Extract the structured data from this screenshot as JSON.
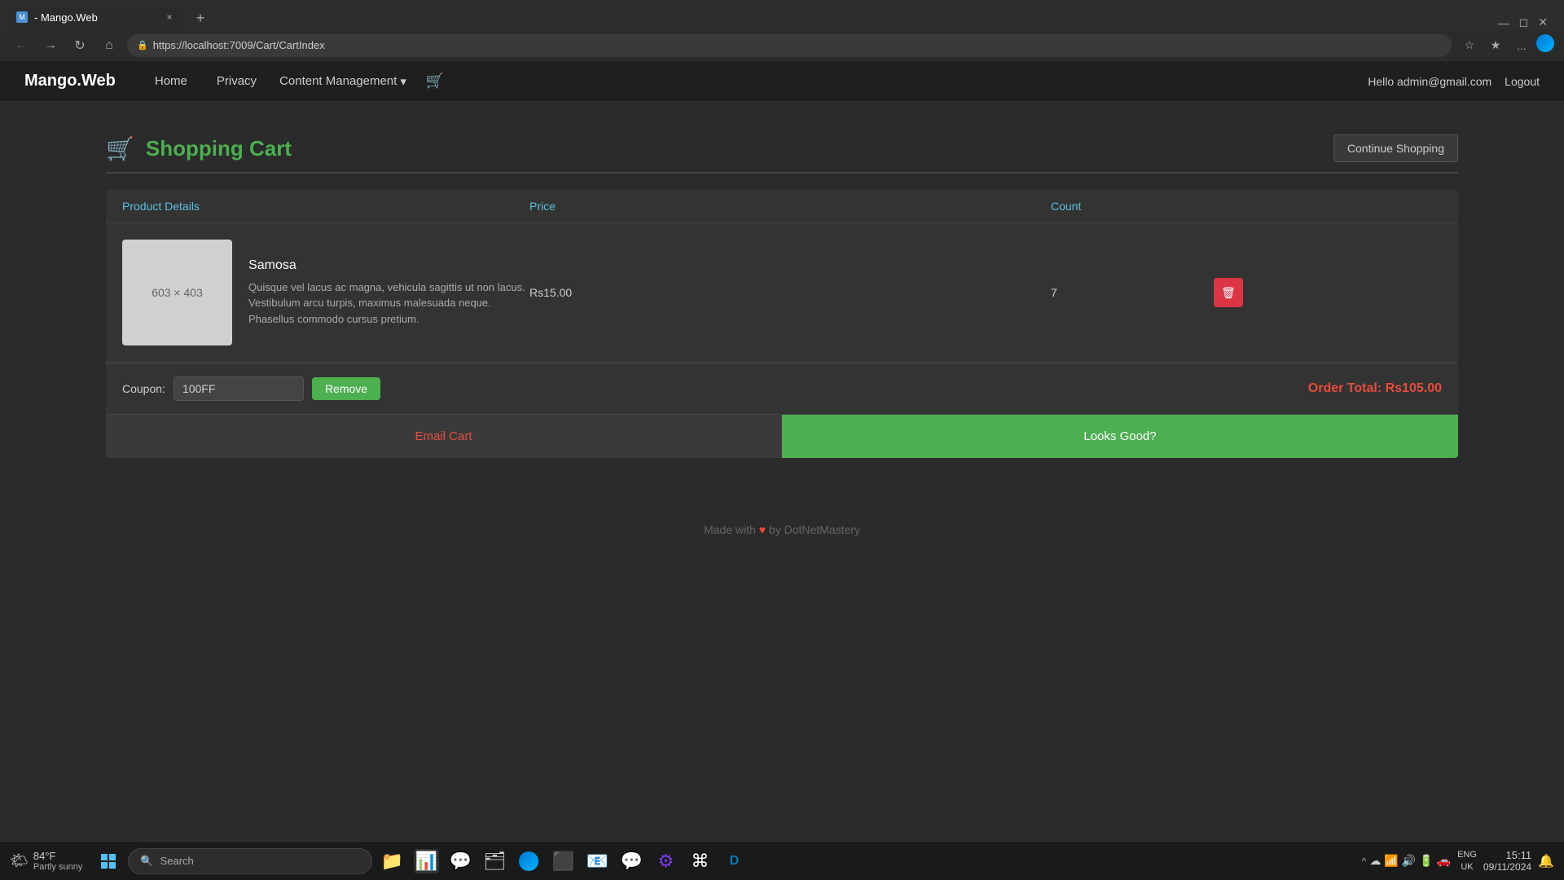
{
  "browser": {
    "tab": {
      "favicon_text": "M",
      "title": "- Mango.Web",
      "close_label": "×",
      "new_tab_label": "+"
    },
    "toolbar": {
      "back_label": "←",
      "forward_label": "→",
      "refresh_label": "↻",
      "home_label": "⌂",
      "url": "https://localhost:7009/Cart/CartIndex",
      "star_label": "☆",
      "fav_label": "★",
      "more_label": "...",
      "user_icon_label": "👤"
    }
  },
  "nav": {
    "brand": "Mango.Web",
    "links": [
      "Home",
      "Privacy"
    ],
    "dropdown": {
      "label": "Content Management",
      "arrow": "▾"
    },
    "cart_icon": "🛒",
    "user_greeting": "Hello admin@gmail.com",
    "logout_label": "Logout"
  },
  "cart": {
    "title": "Shopping Cart",
    "continue_shopping": "Continue Shopping",
    "table": {
      "headers": [
        "Product Details",
        "Price",
        "Count",
        ""
      ],
      "rows": [
        {
          "image_placeholder": "603 × 403",
          "name": "Samosa",
          "description_line1": "Quisque vel lacus ac magna, vehicula sagittis ut non lacus.",
          "description_line2": "Vestibulum arcu turpis, maximus malesuada neque. Phasellus commodo cursus pretium.",
          "price": "Rs15.00",
          "count": "7",
          "delete_icon": "🗑"
        }
      ]
    },
    "coupon": {
      "label": "Coupon:",
      "value": "100FF",
      "remove_label": "Remove"
    },
    "order_total_label": "Order Total: Rs105.00",
    "email_cart_label": "Email Cart",
    "looks_good_label": "Looks Good?"
  },
  "footer": {
    "text_prefix": "Made with",
    "heart": "♥",
    "text_suffix": "by DotNetMastery"
  },
  "taskbar": {
    "weather": {
      "temperature": "84°F",
      "condition": "Partly sunny"
    },
    "search_placeholder": "Search",
    "time": "15:11",
    "date": "09/11/2024",
    "locale": "ENG\nUK"
  }
}
